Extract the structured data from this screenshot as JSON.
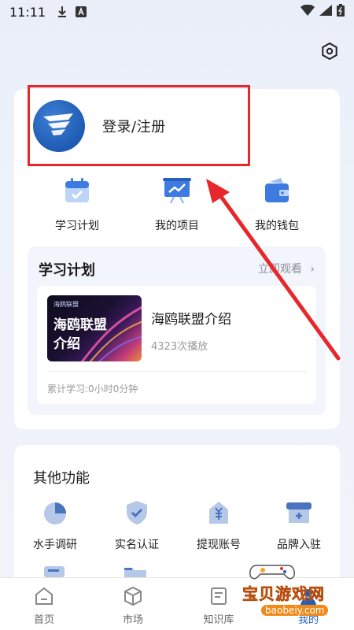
{
  "status_bar": {
    "time": "11:11"
  },
  "profile": {
    "login_label": "登录/注册"
  },
  "quick_actions": [
    {
      "label": "学习计划",
      "icon": "calendar-check-icon"
    },
    {
      "label": "我的项目",
      "icon": "presentation-chart-icon"
    },
    {
      "label": "我的钱包",
      "icon": "wallet-icon"
    }
  ],
  "study_plan": {
    "title": "学习计划",
    "more_label": "立即观看",
    "course": {
      "thumbnail_brand": "海鸥联盟",
      "thumbnail_title": "海鸥联盟介绍",
      "name": "海鸥联盟介绍",
      "plays": "4323次播放"
    },
    "total_study": "累计学习:0小时0分钟"
  },
  "other_functions": {
    "title": "其他功能",
    "items": [
      {
        "label": "水手调研",
        "icon": "pie-chart-icon"
      },
      {
        "label": "实名认证",
        "icon": "shield-check-icon"
      },
      {
        "label": "提现账号",
        "icon": "yen-house-icon"
      },
      {
        "label": "品牌入驻",
        "icon": "store-icon"
      }
    ]
  },
  "tab_bar": [
    {
      "label": "首页",
      "icon": "home-icon"
    },
    {
      "label": "市场",
      "icon": "cube-icon"
    },
    {
      "label": "知识库",
      "icon": "book-icon"
    },
    {
      "label": "我的",
      "icon": "user-icon"
    }
  ],
  "watermark": {
    "text": "宝贝游戏网",
    "url": "baobeiy.com"
  },
  "colors": {
    "accent": "#1f5fc2",
    "annotation": "#e8272b"
  }
}
